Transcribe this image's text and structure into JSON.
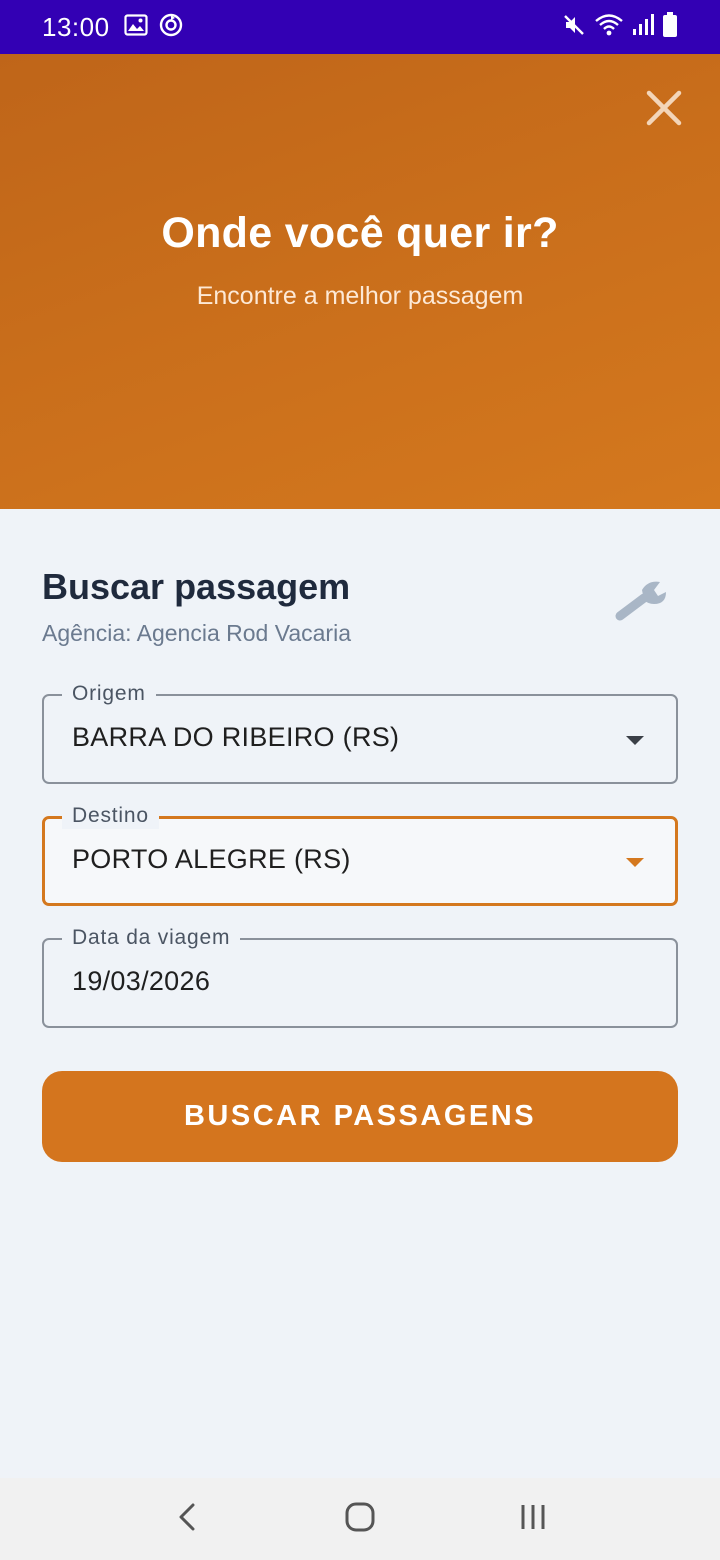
{
  "status_bar": {
    "time": "13:00",
    "left_icons": [
      "image-icon",
      "sync-icon"
    ],
    "right_icons": [
      "mute-icon",
      "wifi-icon",
      "signal-icon",
      "battery-icon"
    ]
  },
  "hero": {
    "title": "Onde você quer ir?",
    "subtitle": "Encontre a melhor passagem",
    "close_icon": "close-icon"
  },
  "search": {
    "title": "Buscar passagem",
    "agency_text": "Agência: Agencia Rod Vacaria",
    "settings_icon": "wrench-icon",
    "fields": {
      "origin": {
        "label": "Origem",
        "value": "BARRA DO RIBEIRO (RS)"
      },
      "destination": {
        "label": "Destino",
        "value": "PORTO ALEGRE (RS)"
      },
      "date": {
        "label": "Data da viagem",
        "value": "19/03/2026"
      }
    },
    "button_label": "BUSCAR PASSAGENS"
  },
  "nav_bar": {
    "icons": [
      "back-icon",
      "home-icon",
      "recents-icon"
    ]
  },
  "colors": {
    "status_bar": "#3300b4",
    "accent": "#d4781e",
    "background": "#eff3f8"
  }
}
